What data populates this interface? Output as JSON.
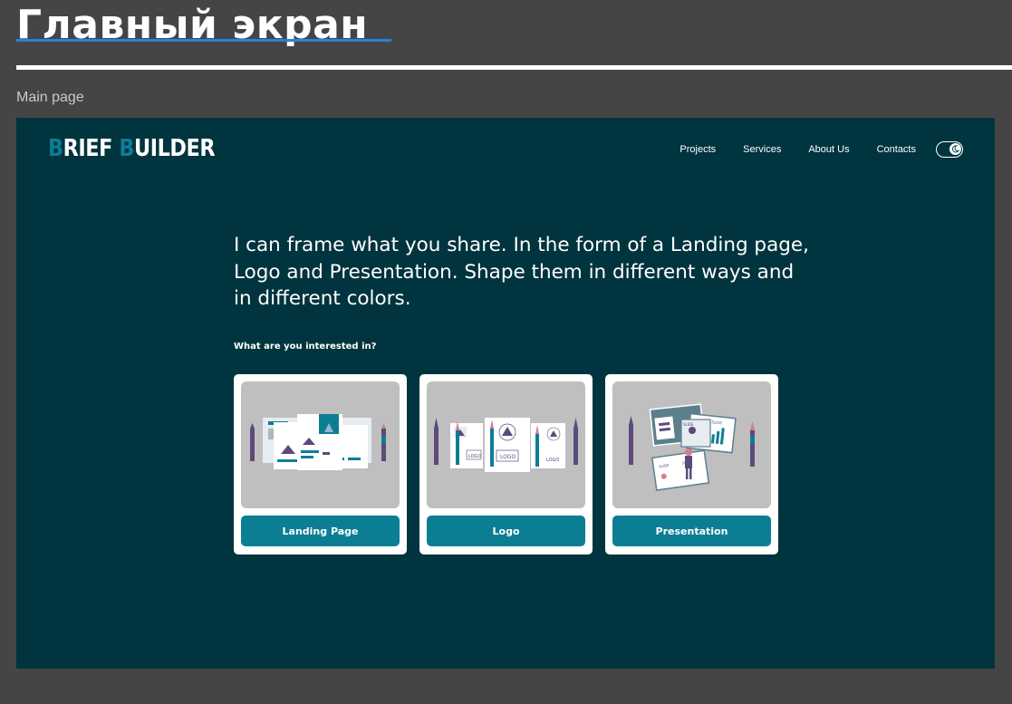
{
  "board": {
    "title": "Главный экран",
    "frame_label": "Main page"
  },
  "site": {
    "logo": {
      "first_initial": "B",
      "first_rest": "RIEF ",
      "second_initial": "B",
      "second_rest": "UILDER"
    },
    "nav": [
      {
        "label": "Projects"
      },
      {
        "label": "Services"
      },
      {
        "label": "About Us"
      },
      {
        "label": "Contacts"
      }
    ],
    "theme_toggle": {
      "icon": "moon-icon",
      "state": "on"
    },
    "headline": "I can frame what you share. In the form of a Landing page, Logo and Presentation. Shape them in different ways and in different colors.",
    "question": "What are you interested in?",
    "cards": [
      {
        "label": "Landing Page",
        "illustration": "landing-page-illustration"
      },
      {
        "label": "Logo",
        "illustration": "logo-illustration",
        "mockup_text": "LOGO"
      },
      {
        "label": "Presentation",
        "illustration": "presentation-illustration",
        "mockup_text": "SLIDE"
      }
    ]
  },
  "colors": {
    "board_bg": "#454545",
    "frame_bg": "#00343e",
    "accent": "#0c7e94",
    "card_image_bg": "#bfbfbf",
    "title_underline": "#2f7fd6"
  }
}
